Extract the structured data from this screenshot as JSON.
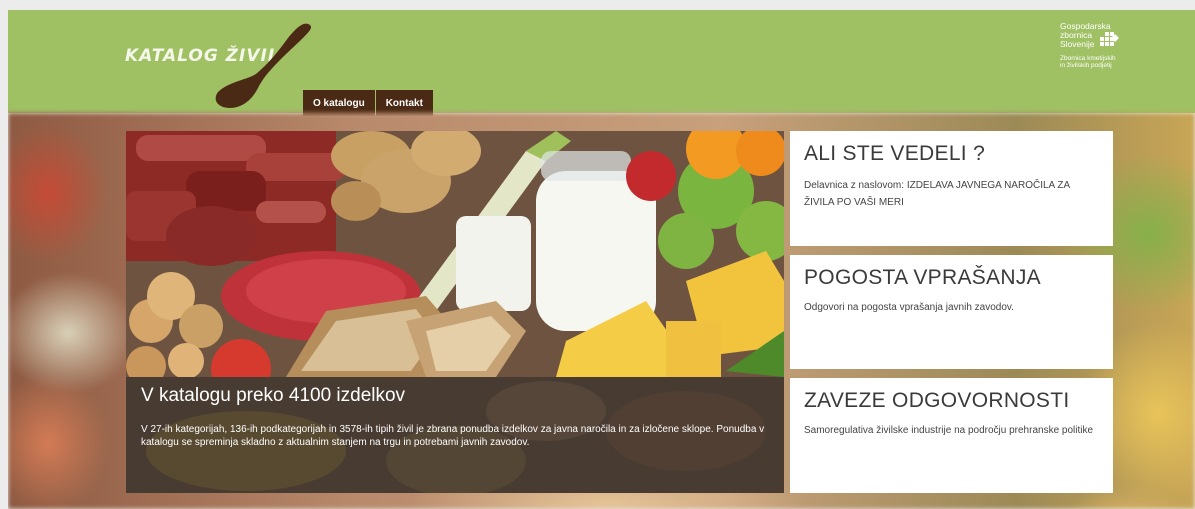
{
  "header": {
    "logo_text": "KATALOG ŽIVIL",
    "nav": [
      {
        "label": "O katalogu"
      },
      {
        "label": "Kontakt"
      }
    ],
    "partner": {
      "name_line1": "Gospodarska",
      "name_line2": "zbornica",
      "name_line3": "Slovenije",
      "sub_line1": "Zbornica kmetijskih",
      "sub_line2": "in živilskih podjetij"
    }
  },
  "hero": {
    "title": "V katalogu preko 4100 izdelkov",
    "text": "V 27-ih kategorijah, 136-ih podkategorijah in 3578-ih tipih živil je zbrana ponudba izdelkov za javna naročila in za izločene sklope. Ponudba v katalogu se spreminja skladno z aktualnim stanjem na trgu in potrebami javnih zavodov."
  },
  "cards": [
    {
      "title": "ALI STE VEDELI ?",
      "text": "Delavnica z naslovom: IZDELAVA JAVNEGA NAROČILA ZA ŽIVILA PO VAŠI MERI"
    },
    {
      "title": "POGOSTA VPRAŠANJA",
      "text": "Odgovori na pogosta vprašanja javnih zavodov."
    },
    {
      "title": "ZAVEZE ODGOVORNOSTI",
      "text": "Samoregulativa živilske industrije na področju prehranske politike"
    }
  ],
  "colors": {
    "header_green": "#a0c064",
    "nav_brown": "#4a2a14"
  }
}
